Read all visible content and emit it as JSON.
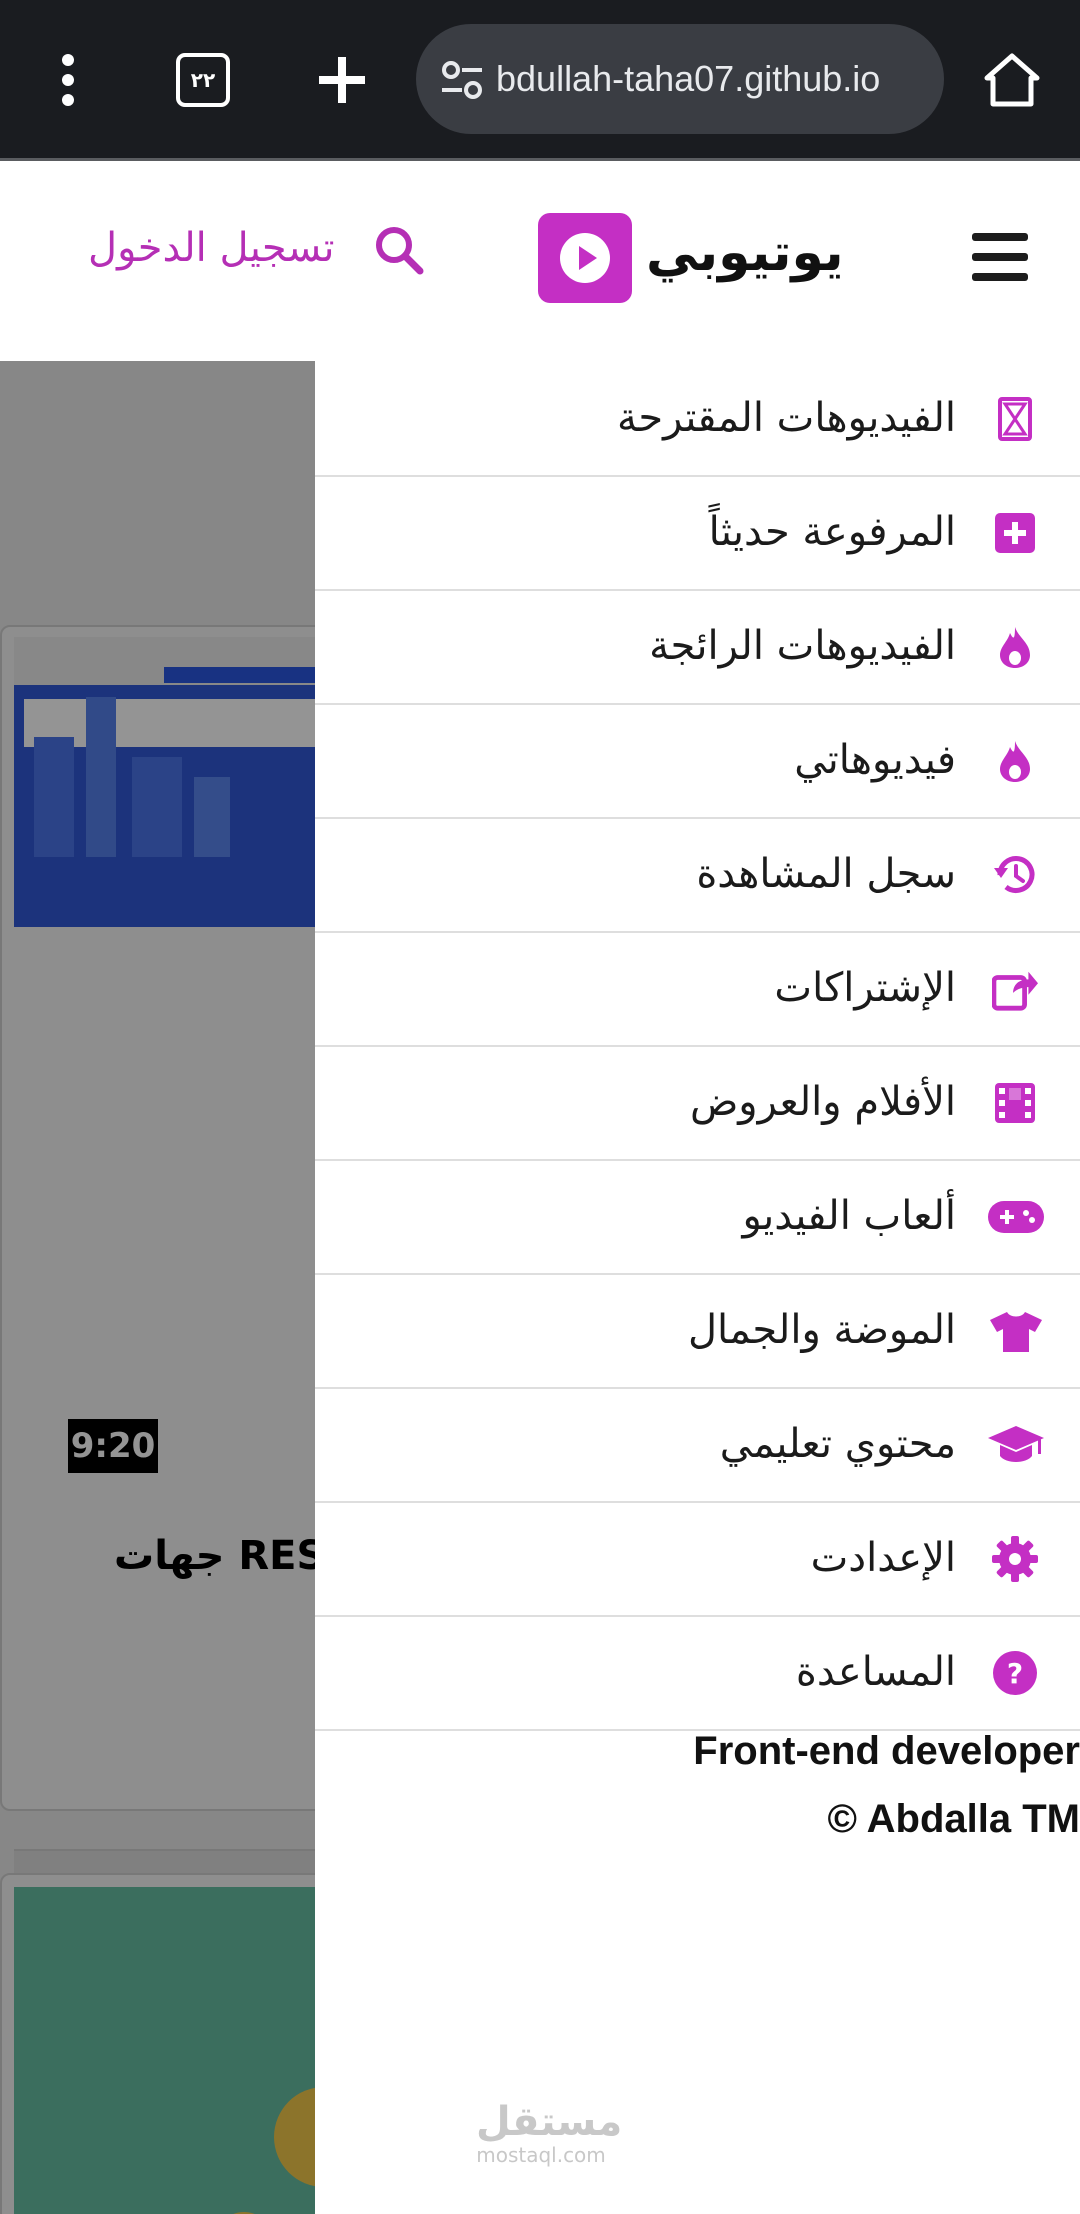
{
  "browser": {
    "url": "bdullah-taha07.github.io",
    "tab_count": "٢٢"
  },
  "header": {
    "brand": "يوتيوبي",
    "login_label": "تسجيل الدخول"
  },
  "background_content": {
    "video": {
      "duration": "9:20",
      "title_fragment": "جهات REST"
    }
  },
  "drawer": {
    "items": [
      {
        "label": "الفيديوهات المقترحة",
        "icon": "hourglass-icon"
      },
      {
        "label": "المرفوعة حديثاً",
        "icon": "plus-square-icon"
      },
      {
        "label": "الفيديوهات الرائجة",
        "icon": "fire-icon"
      },
      {
        "label": "فيديوهاتي",
        "icon": "fire-icon"
      },
      {
        "label": "سجل المشاهدة",
        "icon": "history-icon"
      },
      {
        "label": "الإشتراكات",
        "icon": "share-icon"
      },
      {
        "label": "الأفلام والعروض",
        "icon": "film-icon"
      },
      {
        "label": "ألعاب الفيديو",
        "icon": "gamepad-icon"
      },
      {
        "label": "الموضة والجمال",
        "icon": "tshirt-icon"
      },
      {
        "label": "محتوي تعليمي",
        "icon": "graduation-cap-icon"
      },
      {
        "label": "الإعدادت",
        "icon": "gear-icon"
      },
      {
        "label": "المساعدة",
        "icon": "question-circle-icon"
      }
    ],
    "footer_role": "Front-end developer",
    "footer_copyright": "© Abdalla TM"
  },
  "watermark": {
    "arabic": "مستقل",
    "latin": "mostaql.com"
  },
  "colors": {
    "accent": "#c42fc4",
    "chrome_bg": "#1a1c20"
  }
}
